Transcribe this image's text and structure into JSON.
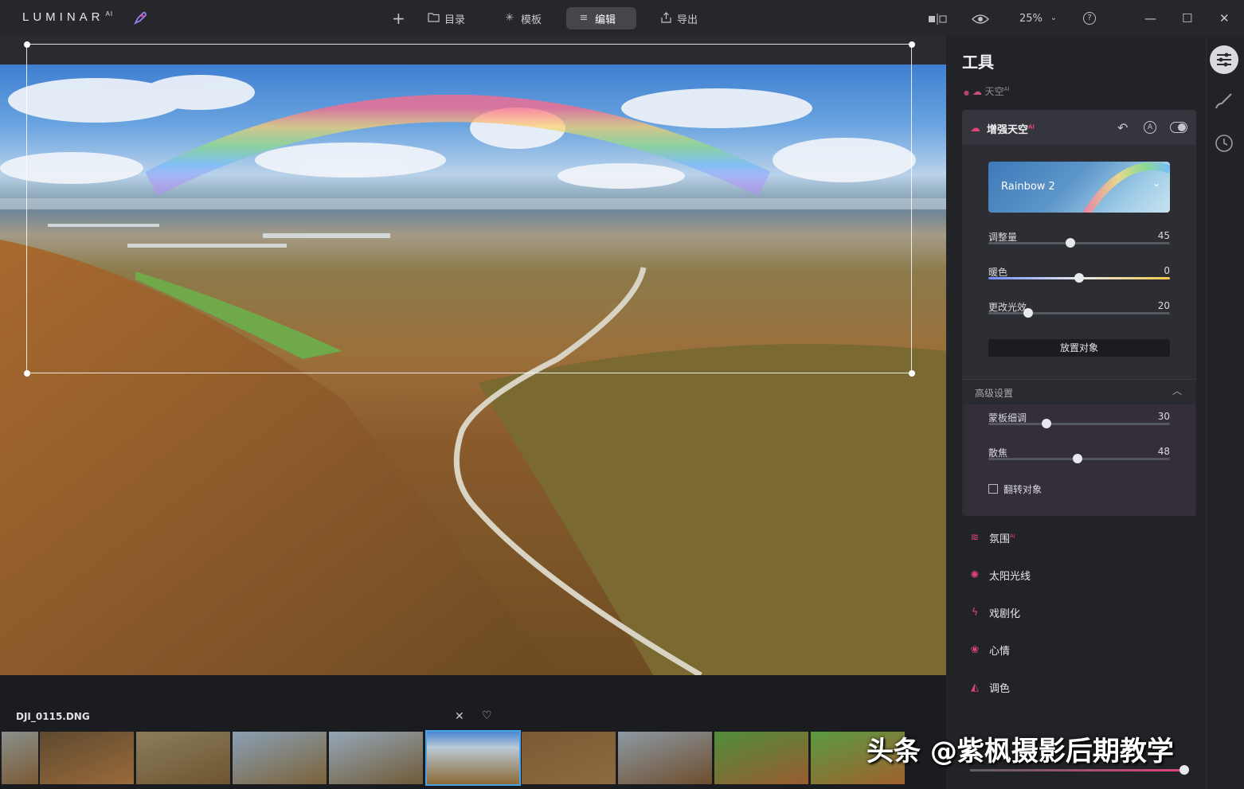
{
  "app": {
    "logo_text": "LUMINAR",
    "logo_sup": "AI"
  },
  "toolbar": {
    "add_label": "+",
    "catalog_label": "目录",
    "templates_label": "模板",
    "edit_label": "编辑",
    "export_label": "导出",
    "zoom_label": "25%",
    "help_label": "?"
  },
  "window": {
    "minimize": "—",
    "maximize": "☐",
    "close": "✕"
  },
  "filmstrip": {
    "filename": "DJI_0115.DNG",
    "thumb_count": 10,
    "selected_index": 5
  },
  "panel": {
    "title": "工具",
    "sky_row_label": "天空",
    "sky_row_sup": "AI",
    "card": {
      "title": "增强天空",
      "title_sup": "AI",
      "preset_label": "Rainbow 2",
      "sliders": [
        {
          "label": "调整量",
          "value": "45",
          "fraction": 0.45
        },
        {
          "label": "暖色",
          "value": "0",
          "fraction": 0.5
        },
        {
          "label": "更改光效",
          "value": "20",
          "fraction": 0.22
        }
      ],
      "place_button": "放置对象",
      "advanced_label": "高级设置",
      "adv_sliders": [
        {
          "label": "蒙板细调",
          "value": "30",
          "fraction": 0.32
        },
        {
          "label": "散焦",
          "value": "48",
          "fraction": 0.49
        }
      ],
      "flip_label": "翻转对象"
    },
    "tools": [
      {
        "label": "氛围",
        "sup": "AI"
      },
      {
        "label": "太阳光线",
        "sup": ""
      },
      {
        "label": "戏剧化",
        "sup": ""
      },
      {
        "label": "心情",
        "sup": ""
      },
      {
        "label": "调色",
        "sup": ""
      }
    ]
  },
  "watermark": "头条 @紫枫摄影后期教学",
  "colors": {
    "accent": "#e0447b",
    "topbar": "#26272b",
    "panel": "#222327"
  }
}
